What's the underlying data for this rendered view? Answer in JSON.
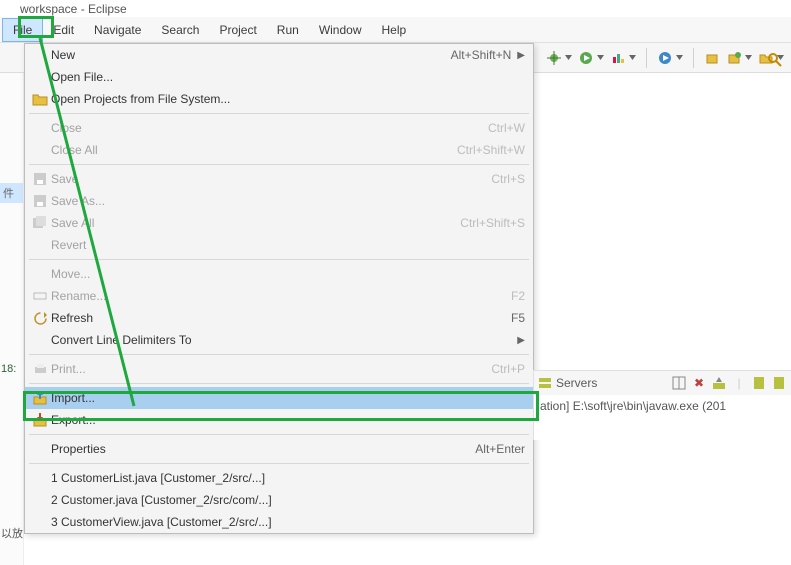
{
  "window": {
    "title": "workspace - Eclipse"
  },
  "menu": {
    "file": "File",
    "edit": "Edit",
    "navigate": "Navigate",
    "search": "Search",
    "project": "Project",
    "run": "Run",
    "window": "Window",
    "help": "Help"
  },
  "file_menu": {
    "new": {
      "label": "New",
      "accel": "Alt+Shift+N",
      "submenu": true
    },
    "open_file": {
      "label": "Open File..."
    },
    "open_projects": {
      "label": "Open Projects from File System..."
    },
    "close": {
      "label": "Close",
      "accel": "Ctrl+W",
      "disabled": true
    },
    "close_all": {
      "label": "Close All",
      "accel": "Ctrl+Shift+W",
      "disabled": true
    },
    "save": {
      "label": "Save",
      "accel": "Ctrl+S",
      "disabled": true
    },
    "save_as": {
      "label": "Save As...",
      "disabled": true
    },
    "save_all": {
      "label": "Save All",
      "accel": "Ctrl+Shift+S",
      "disabled": true
    },
    "revert": {
      "label": "Revert",
      "disabled": true
    },
    "move": {
      "label": "Move...",
      "disabled": true
    },
    "rename": {
      "label": "Rename...",
      "accel": "F2",
      "disabled": true
    },
    "refresh": {
      "label": "Refresh",
      "accel": "F5"
    },
    "convert": {
      "label": "Convert Line Delimiters To",
      "submenu": true
    },
    "print": {
      "label": "Print...",
      "accel": "Ctrl+P",
      "disabled": true
    },
    "import": {
      "label": "Import..."
    },
    "export": {
      "label": "Export..."
    },
    "properties": {
      "label": "Properties",
      "accel": "Alt+Enter"
    },
    "recent1": {
      "label": "1 CustomerList.java  [Customer_2/src/...]"
    },
    "recent2": {
      "label": "2 Customer.java  [Customer_2/src/com/...]"
    },
    "recent3": {
      "label": "3 CustomerView.java  [Customer_2/src/...]"
    }
  },
  "gutter": {
    "item": "件",
    "time": "18:",
    "cn": "以放"
  },
  "servers": {
    "title": "Servers",
    "body": "ation] E:\\soft\\jre\\bin\\javaw.exe (201"
  }
}
